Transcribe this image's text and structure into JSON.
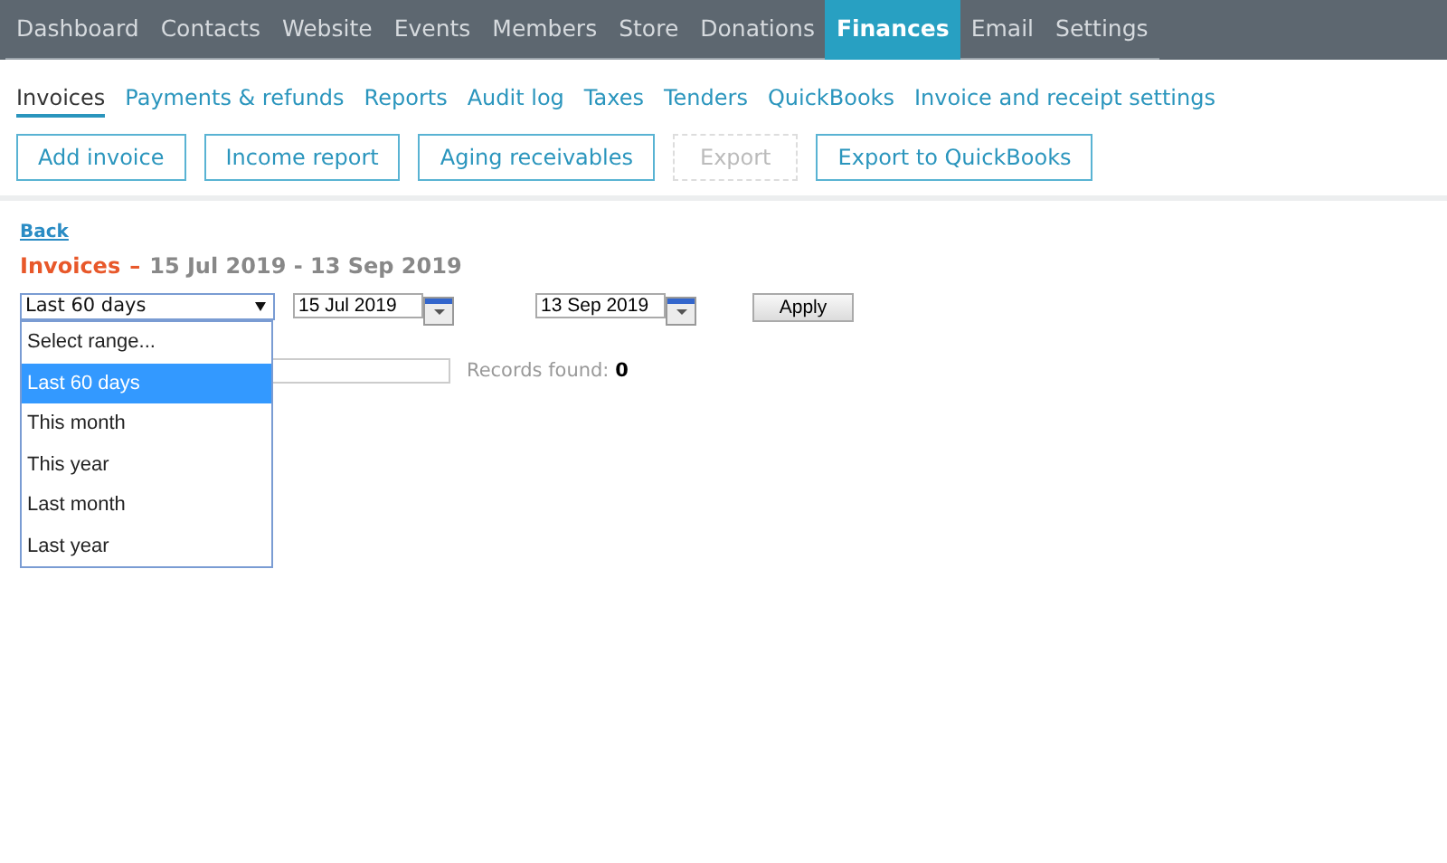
{
  "top_nav": [
    {
      "label": "Dashboard",
      "selected": false
    },
    {
      "label": "Contacts",
      "selected": false
    },
    {
      "label": "Website",
      "selected": false
    },
    {
      "label": "Events",
      "selected": false
    },
    {
      "label": "Members",
      "selected": false
    },
    {
      "label": "Store",
      "selected": false
    },
    {
      "label": "Donations",
      "selected": false
    },
    {
      "label": "Finances",
      "selected": true
    },
    {
      "label": "Email",
      "selected": false
    },
    {
      "label": "Settings",
      "selected": false
    }
  ],
  "sub_tabs": [
    {
      "label": "Invoices",
      "selected": true
    },
    {
      "label": "Payments & refunds",
      "selected": false
    },
    {
      "label": "Reports",
      "selected": false
    },
    {
      "label": "Audit log",
      "selected": false
    },
    {
      "label": "Taxes",
      "selected": false
    },
    {
      "label": "Tenders",
      "selected": false
    },
    {
      "label": "QuickBooks",
      "selected": false
    },
    {
      "label": "Invoice and receipt settings",
      "selected": false
    }
  ],
  "actions": [
    {
      "label": "Add invoice",
      "disabled": false
    },
    {
      "label": "Income report",
      "disabled": false
    },
    {
      "label": "Aging receivables",
      "disabled": false
    },
    {
      "label": "Export",
      "disabled": true
    },
    {
      "label": "Export to QuickBooks",
      "disabled": false
    }
  ],
  "back_link": "Back",
  "heading": {
    "title": "Invoices",
    "dash": "–",
    "range": "15 Jul 2019 - 13 Sep 2019"
  },
  "filter": {
    "range_select": "Last 60 days",
    "from_date": "15 Jul 2019",
    "to_date": "13 Sep 2019",
    "apply": "Apply"
  },
  "range_options": [
    {
      "label": "Select range...",
      "selected": false
    },
    {
      "label": "Last 60 days",
      "selected": true
    },
    {
      "label": "This month",
      "selected": false
    },
    {
      "label": "This year",
      "selected": false
    },
    {
      "label": "Last month",
      "selected": false
    },
    {
      "label": "Last year",
      "selected": false
    }
  ],
  "records": {
    "label": "Records found:",
    "count": "0"
  }
}
